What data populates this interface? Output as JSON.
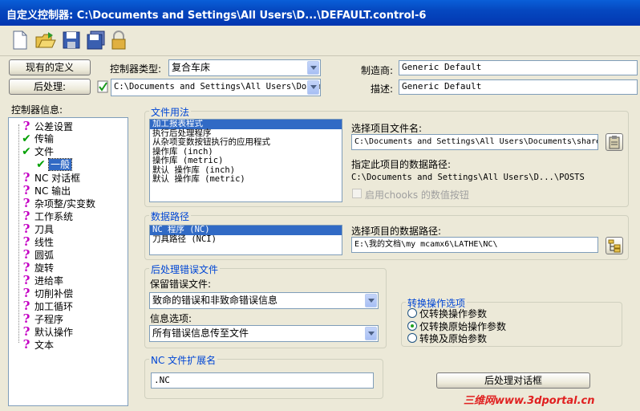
{
  "window": {
    "title": "自定义控制器: C:\\Documents and Settings\\All Users\\D...\\DEFAULT.control-6"
  },
  "toolbar": {
    "icons": [
      "new-file-icon",
      "open-folder-icon",
      "save-icon",
      "save-all-icon",
      "lock-icon"
    ]
  },
  "top": {
    "current_def_button": "现有的定义",
    "post_button": "后处理:",
    "controller_type_label": "控制器类型:",
    "controller_type_value": "复合车床",
    "post_path": "C:\\Documents and Settings\\All Users\\Documents\\",
    "manufacturer_label": "制造商:",
    "manufacturer_value": "Generic Default",
    "description_label": "描述:",
    "description_value": "Generic Default"
  },
  "tree": {
    "header": "控制器信息:",
    "items": [
      {
        "label": "公差设置",
        "icon": "question"
      },
      {
        "label": "传输",
        "icon": "check"
      },
      {
        "label": "文件",
        "icon": "check"
      },
      {
        "label": "一般",
        "icon": "check",
        "selected": true
      },
      {
        "label": "NC 对话框",
        "icon": "question"
      },
      {
        "label": "NC 输出",
        "icon": "question"
      },
      {
        "label": "杂项整/实变数",
        "icon": "question"
      },
      {
        "label": "工作系统",
        "icon": "question"
      },
      {
        "label": "刀具",
        "icon": "question"
      },
      {
        "label": "线性",
        "icon": "question"
      },
      {
        "label": "圆弧",
        "icon": "question"
      },
      {
        "label": "旋转",
        "icon": "question"
      },
      {
        "label": "进给率",
        "icon": "question"
      },
      {
        "label": "切削补偿",
        "icon": "question"
      },
      {
        "label": "加工循环",
        "icon": "question"
      },
      {
        "label": "子程序",
        "icon": "question"
      },
      {
        "label": "默认操作",
        "icon": "question"
      },
      {
        "label": "文本",
        "icon": "question"
      }
    ]
  },
  "file_usage": {
    "title": "文件用法",
    "items": [
      "加工报表程式",
      "执行后处理程序",
      "从杂项变数按钮执行的应用程式",
      "操作库 (inch)",
      "操作库 (metric)",
      "默认 操作库 (inch)",
      "默认 操作库 (metric)"
    ],
    "select_file_label": "选择项目文件名:",
    "select_file_value": "C:\\Documents and Settings\\All Users\\Documents\\shared",
    "data_path_label": "指定此项目的数据路径:",
    "data_path_value": "C:\\Documents and Settings\\All Users\\D...\\POSTS",
    "chooks_label": "启用chooks 的数值按钮"
  },
  "data_path": {
    "title": "数据路径",
    "items": [
      "NC 程序 (NC)",
      "刀具路径 (NCI)"
    ],
    "select_label": "选择项目的数据路径:",
    "select_value": "E:\\我的文档\\my mcamx6\\LATHE\\NC\\"
  },
  "post_error": {
    "title": "后处理错误文件",
    "keep_label": "保留错误文件:",
    "keep_value": "致命的错误和非致命错误信息",
    "info_label": "信息选项:",
    "info_value": "所有错误信息传至文件"
  },
  "convert": {
    "title": "转换操作选项",
    "options": [
      "仅转换操作参数",
      "仅转换原始操作参数",
      "转换及原始参数"
    ],
    "selected": 1
  },
  "nc_ext": {
    "title": "NC 文件扩展名",
    "value": ".NC"
  },
  "post_dialog_button": "后处理对话框",
  "watermark": "三维网www.3dportal.cn"
}
